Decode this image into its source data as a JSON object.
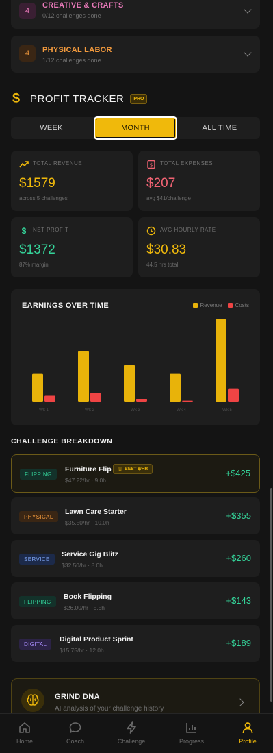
{
  "categories": [
    {
      "num": "4",
      "title": "CREATIVE & CRAFTS",
      "sub": "0/12 challenges done",
      "color": "#e879b9",
      "numbg": "#3a1f33"
    },
    {
      "num": "4",
      "title": "PHYSICAL LABOR",
      "sub": "1/12 challenges done",
      "color": "#f39a3d",
      "numbg": "#3a2614"
    }
  ],
  "profit_tracker": {
    "title": "PROFIT TRACKER",
    "badge": "PRO",
    "tabs": [
      "WEEK",
      "MONTH",
      "ALL TIME"
    ],
    "active_tab": "MONTH"
  },
  "stats": {
    "revenue": {
      "label": "TOTAL REVENUE",
      "value": "$1579",
      "note": "across 5 challenges",
      "color": "#f0b90b"
    },
    "expenses": {
      "label": "TOTAL EXPENSES",
      "value": "$207",
      "note": "avg $41/challenge",
      "color": "#f16373"
    },
    "profit": {
      "label": "NET PROFIT",
      "value": "$1372",
      "note": "87% margin",
      "color": "#34d399"
    },
    "hourly": {
      "label": "AVG HOURLY RATE",
      "value": "$30.83",
      "note": "44.5 hrs total",
      "color": "#f0b90b"
    }
  },
  "chart_data": {
    "type": "bar",
    "title": "EARNINGS OVER TIME",
    "categories": [
      "Wk 1",
      "Wk 2",
      "Wk 3",
      "Wk 4",
      "Wk 5"
    ],
    "series": [
      {
        "name": "Revenue",
        "color": "#e8b30a",
        "values": [
          143,
          260,
          189,
          143,
          425
        ]
      },
      {
        "name": "Costs",
        "color": "#ef4444",
        "values": [
          30,
          45,
          13,
          5,
          65
        ]
      }
    ],
    "ylim": [
      0,
      425
    ],
    "legend": "top-right",
    "grid": false
  },
  "breakdown": {
    "title": "CHALLENGE BREAKDOWN",
    "best_label": "BEST $/HR",
    "rows": [
      {
        "tag": "FLIPPING",
        "name": "Furniture Flip",
        "meta": "$47.22/hr · 9.0h",
        "amount": "+$425",
        "best": true
      },
      {
        "tag": "PHYSICAL",
        "name": "Lawn Care Starter",
        "meta": "$35.50/hr · 10.0h",
        "amount": "+$355",
        "best": false
      },
      {
        "tag": "SERVICE",
        "name": "Service Gig Blitz",
        "meta": "$32.50/hr · 8.0h",
        "amount": "+$260",
        "best": false
      },
      {
        "tag": "FLIPPING",
        "name": "Book Flipping",
        "meta": "$26.00/hr · 5.5h",
        "amount": "+$143",
        "best": false
      },
      {
        "tag": "DIGITAL",
        "name": "Digital Product Sprint",
        "meta": "$15.75/hr · 12.0h",
        "amount": "+$189",
        "best": false
      }
    ]
  },
  "grind_dna": {
    "title": "GRIND DNA",
    "subtitle": "AI analysis of your challenge history"
  },
  "nav": [
    {
      "label": "Home",
      "icon": "home-icon"
    },
    {
      "label": "Coach",
      "icon": "chat-icon"
    },
    {
      "label": "Challenge",
      "icon": "bolt-icon"
    },
    {
      "label": "Progress",
      "icon": "bar-chart-icon"
    },
    {
      "label": "Profile",
      "icon": "user-icon",
      "active": true
    }
  ]
}
